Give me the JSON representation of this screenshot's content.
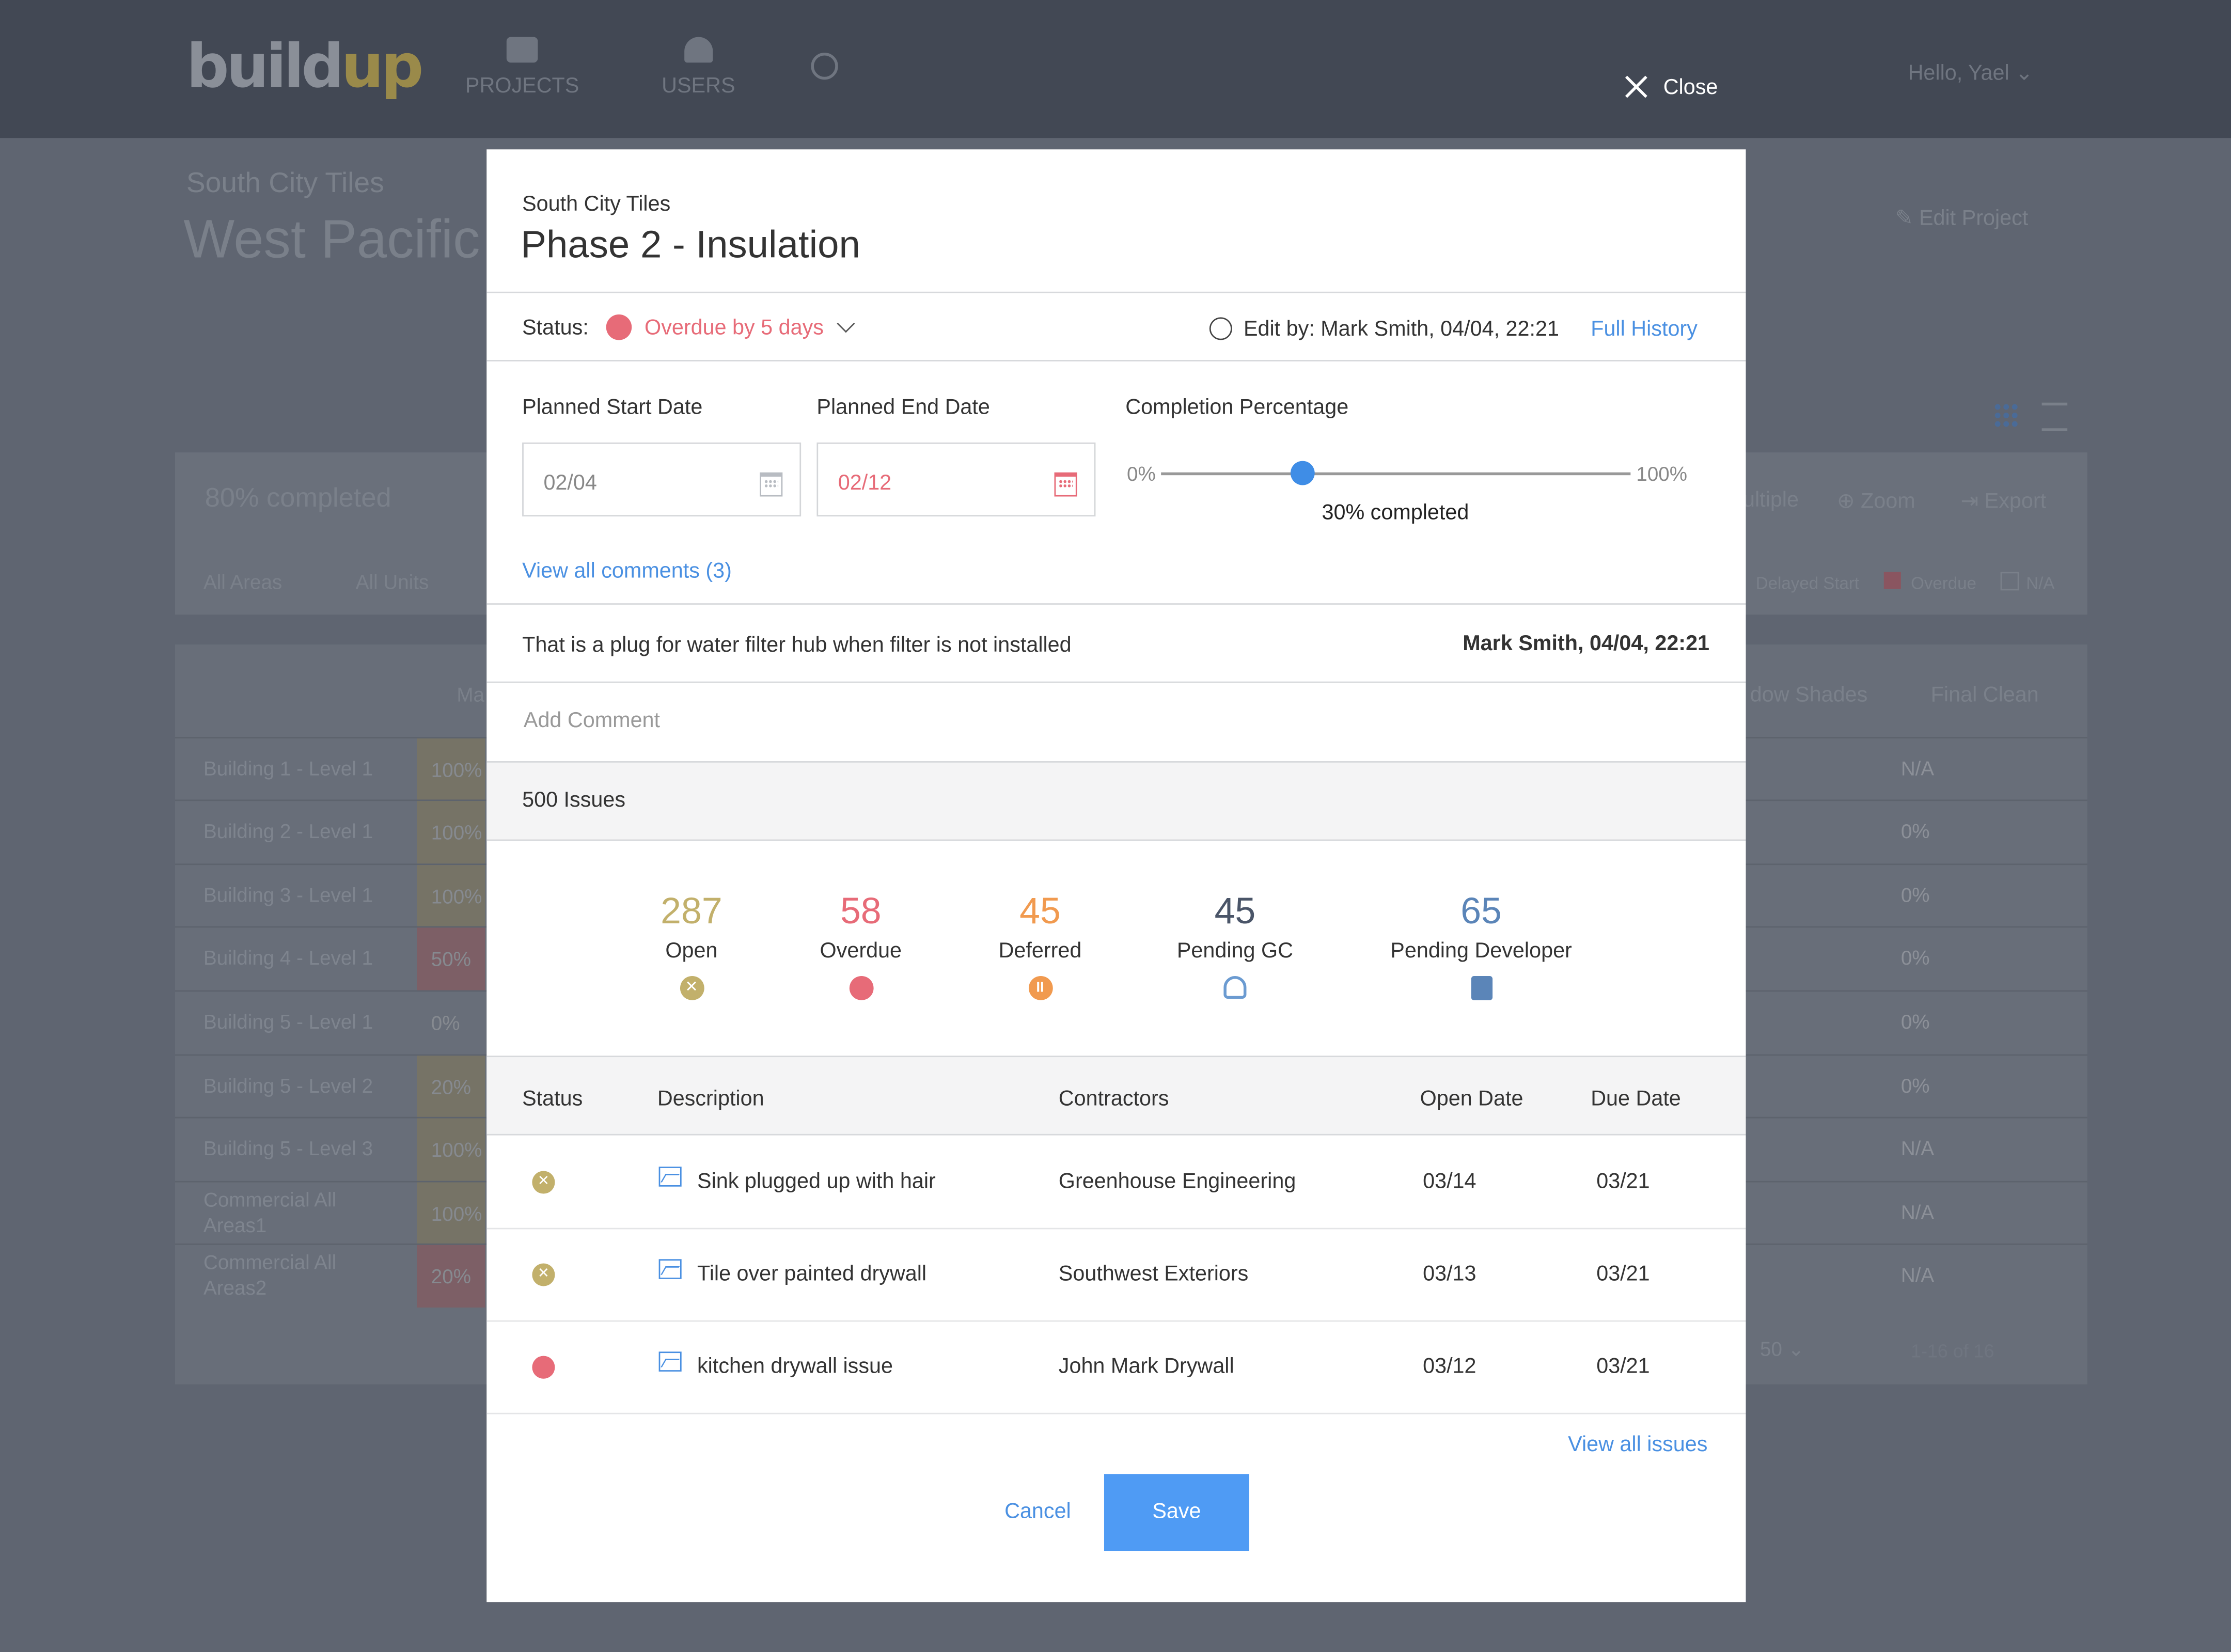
{
  "background": {
    "logo": {
      "part1": "build",
      "part2": "up"
    },
    "nav": [
      {
        "label": "PROJECTS"
      },
      {
        "label": "USERS"
      }
    ],
    "user_greeting": "Hello, Yael",
    "project_client": "South City Tiles",
    "project_title": "West Pacific",
    "edit_project": "Edit Project",
    "completed": "80% completed",
    "filters": [
      "All Areas",
      "All Units"
    ],
    "toolbar": [
      "ultiple",
      "Zoom",
      "Export"
    ],
    "legend": [
      "Delayed Start",
      "Overdue",
      "N/A"
    ],
    "columns": [
      "Ma",
      "dow Shades",
      "Final Clean"
    ],
    "rows": [
      {
        "name": "Building 1 - Level 1",
        "pct": "100%",
        "right": "N/A"
      },
      {
        "name": "Building 2 - Level 1",
        "pct": "100%",
        "right": "0%"
      },
      {
        "name": "Building 3 - Level 1",
        "pct": "100%",
        "right": "0%"
      },
      {
        "name": "Building 4 - Level 1",
        "pct": "50%",
        "right": "0%"
      },
      {
        "name": "Building 5 - Level 1",
        "pct": "0%",
        "right": "0%"
      },
      {
        "name": "Building 5 - Level 2",
        "pct": "20%",
        "right": "0%"
      },
      {
        "name": "Building 5 - Level 3",
        "pct": "100%",
        "right": "N/A"
      },
      {
        "name": "Commercial All Areas1",
        "pct": "100%",
        "right": "N/A"
      },
      {
        "name": "Commercial All Areas2",
        "pct": "20%",
        "right": "N/A"
      }
    ],
    "pager": {
      "per_page": "50",
      "range": "1-16 of 16"
    }
  },
  "close_label": "Close",
  "modal": {
    "client": "South City Tiles",
    "title": "Phase 2 - Insulation",
    "status_label": "Status:",
    "status_value": "Overdue by 5 days",
    "edit_info": "Edit by: Mark Smith, 04/04, 22:21",
    "full_history": "Full History",
    "planned_start_label": "Planned Start Date",
    "planned_start": "02/04",
    "planned_end_label": "Planned End Date",
    "planned_end": "02/12",
    "completion_label": "Completion Percentage",
    "slider_min": "0%",
    "slider_max": "100%",
    "completion_value": 30,
    "completion_text": "30% completed",
    "view_comments": "View all comments (3)",
    "comment": {
      "text": "That is a plug for water filter hub when filter is not installed",
      "author": "Mark Smith, 04/04, 22:21"
    },
    "add_comment_placeholder": "Add Comment",
    "issues_title": "500 Issues",
    "stats": [
      {
        "num": "287",
        "label": "Open",
        "color": "#c2b06b",
        "icon": "x-circle-icon"
      },
      {
        "num": "58",
        "label": "Overdue",
        "color": "#e76b78",
        "icon": "clock-icon"
      },
      {
        "num": "45",
        "label": "Deferred",
        "color": "#f19a4f",
        "icon": "pause-icon"
      },
      {
        "num": "45",
        "label": "Pending GC",
        "color": "#4a5568",
        "icon": "user-icon"
      },
      {
        "num": "65",
        "label": "Pending Developer",
        "color": "#5b85b8",
        "icon": "clipboard-check-icon"
      }
    ],
    "table_headers": [
      "Status",
      "Description",
      "Contractors",
      "Open Date",
      "Due Date"
    ],
    "issues": [
      {
        "status": "open",
        "description": "Sink plugged up with hair",
        "contractor": "Greenhouse Engineering",
        "open": "03/14",
        "due": "03/21"
      },
      {
        "status": "open",
        "description": "Tile over painted drywall",
        "contractor": "Southwest Exteriors",
        "open": "03/13",
        "due": "03/21"
      },
      {
        "status": "overdue",
        "description": "kitchen drywall issue",
        "contractor": "John Mark Drywall",
        "open": "03/12",
        "due": "03/21"
      }
    ],
    "view_all_issues": "View all issues",
    "cancel_label": "Cancel",
    "save_label": "Save"
  }
}
